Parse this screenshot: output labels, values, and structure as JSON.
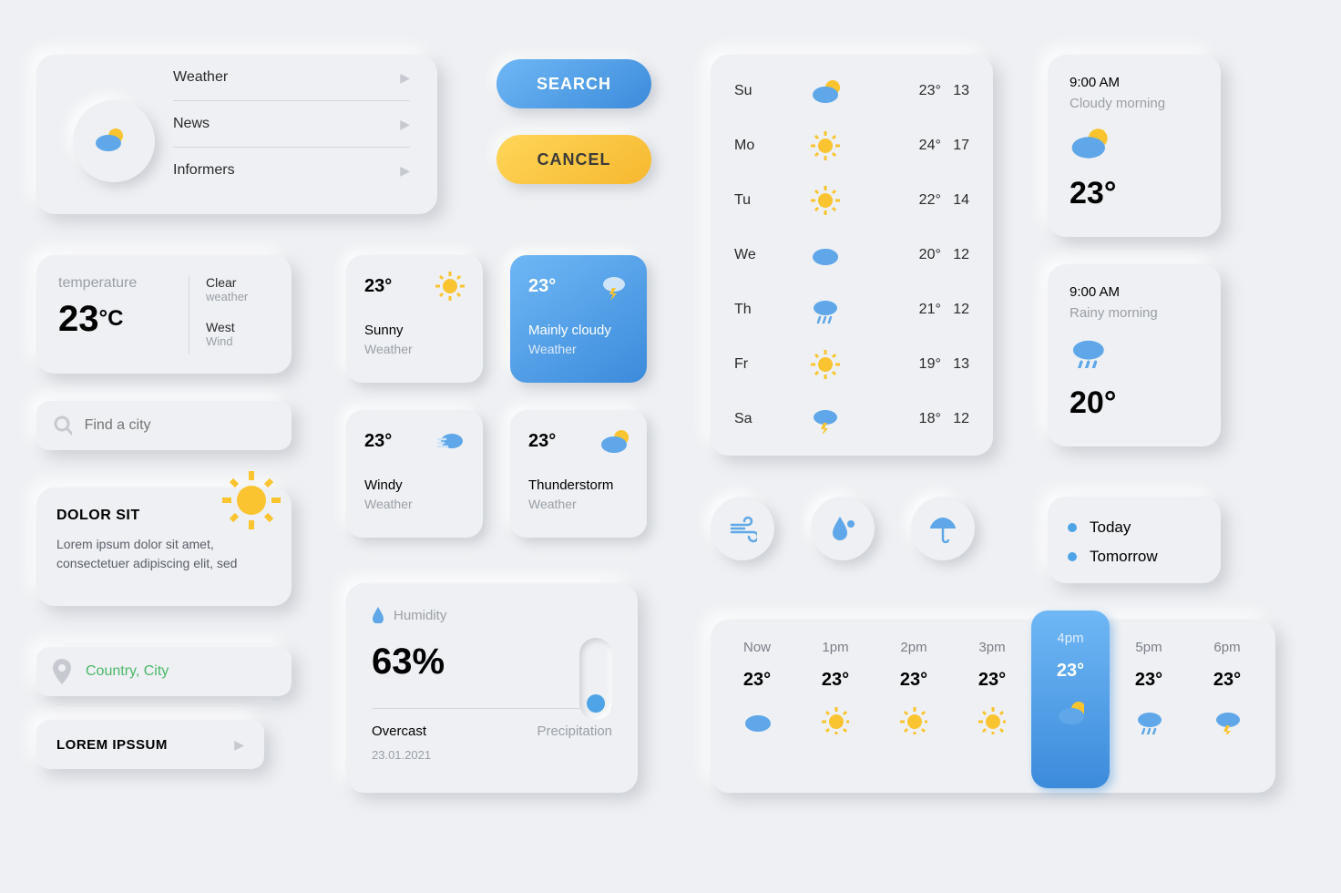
{
  "menu": {
    "items": [
      {
        "label": "Weather"
      },
      {
        "label": "News"
      },
      {
        "label": "Informers"
      }
    ]
  },
  "buttons": {
    "search": "SEARCH",
    "cancel": "CANCEL"
  },
  "temp_card": {
    "label": "temperature",
    "value": "23",
    "unit": "°C",
    "cond_label": "Clear",
    "cond_sub": "weather",
    "wind_label": "West",
    "wind_sub": "Wind"
  },
  "search": {
    "placeholder": "Find a city"
  },
  "dolor": {
    "title": "DOLOR SIT",
    "text": "Lorem ipsum dolor sit amet, consectetuer adipiscing elit, sed"
  },
  "location": {
    "text": "Country, City"
  },
  "lorem_btn": {
    "text": "LOREM IPSSUM"
  },
  "mini_cards": [
    {
      "temp": "23°",
      "title": "Sunny",
      "sub": "Weather",
      "icon": "sun"
    },
    {
      "temp": "23°",
      "title": "Mainly cloudy",
      "sub": "Weather",
      "icon": "cloud-light",
      "blue": true
    },
    {
      "temp": "23°",
      "title": "Windy",
      "sub": "Weather",
      "icon": "wind-cloud"
    },
    {
      "temp": "23°",
      "title": "Thunderstorm",
      "sub": "Weather",
      "icon": "partly"
    }
  ],
  "humidity": {
    "label": "Humidity",
    "value": "63%",
    "overcast": "Overcast",
    "precip": "Precipitation",
    "date": "23.01.2021"
  },
  "weekly": [
    {
      "day": "Su",
      "icon": "partly",
      "hi": "23°",
      "lo": "13"
    },
    {
      "day": "Mo",
      "icon": "sun",
      "hi": "24°",
      "lo": "17"
    },
    {
      "day": "Tu",
      "icon": "sun",
      "hi": "22°",
      "lo": "14"
    },
    {
      "day": "We",
      "icon": "cloud",
      "hi": "20°",
      "lo": "12"
    },
    {
      "day": "Th",
      "icon": "rain",
      "hi": "21°",
      "lo": "12"
    },
    {
      "day": "Fr",
      "icon": "sun",
      "hi": "19°",
      "lo": "13"
    },
    {
      "day": "Sa",
      "icon": "storm",
      "hi": "18°",
      "lo": "12"
    }
  ],
  "now_cards": [
    {
      "time": "9:00 AM",
      "desc": "Cloudy morning",
      "temp": "23°",
      "icon": "partly"
    },
    {
      "time": "9:00 AM",
      "desc": "Rainy morning",
      "temp": "20°",
      "icon": "rain"
    }
  ],
  "tabs": [
    {
      "label": "Today",
      "color": "#4fa4e8"
    },
    {
      "label": "Tomorrow",
      "color": "#4fa4e8"
    }
  ],
  "hourly": [
    {
      "time": "Now",
      "temp": "23°",
      "icon": "cloud"
    },
    {
      "time": "1pm",
      "temp": "23°",
      "icon": "sun"
    },
    {
      "time": "2pm",
      "temp": "23°",
      "icon": "sun"
    },
    {
      "time": "3pm",
      "temp": "23°",
      "icon": "sun"
    },
    {
      "time": "4pm",
      "temp": "23°",
      "icon": "partly",
      "active": true
    },
    {
      "time": "5pm",
      "temp": "23°",
      "icon": "rain"
    },
    {
      "time": "6pm",
      "temp": "23°",
      "icon": "storm"
    }
  ]
}
